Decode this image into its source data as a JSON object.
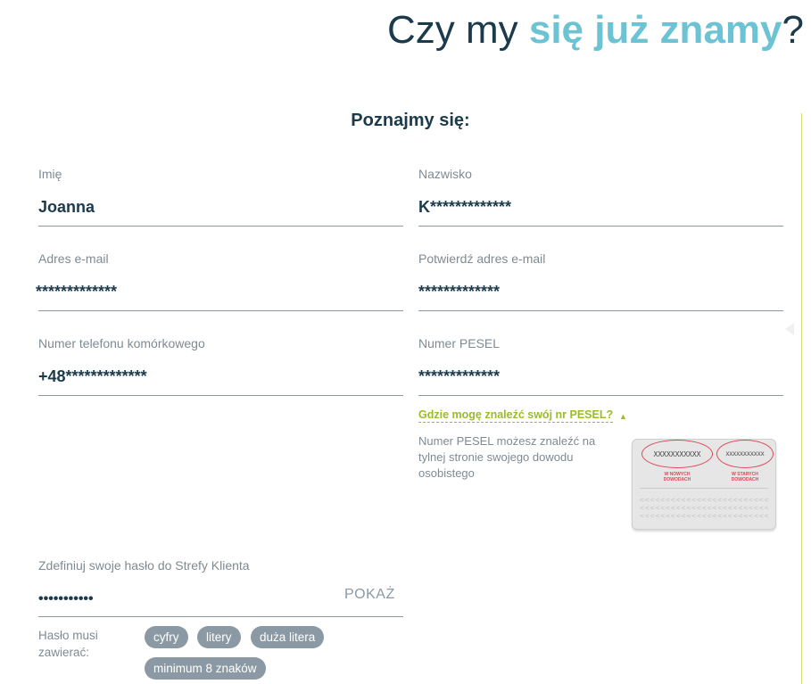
{
  "header": {
    "title_prefix": "Czy my ",
    "title_accent": "się już znamy",
    "title_suffix": "?"
  },
  "form": {
    "section_title": "Poznajmy się:",
    "first_name": {
      "label": "Imię",
      "value": "Joanna"
    },
    "last_name": {
      "label": "Nazwisko",
      "value": "K*************"
    },
    "email": {
      "label": "Adres e-mail",
      "value": "*************"
    },
    "email_confirm": {
      "label": "Potwierdź adres e-mail",
      "value": "*************"
    },
    "phone": {
      "label": "Numer telefonu komórkowego",
      "prefix": "+48",
      "value": "*************"
    },
    "pesel": {
      "label": "Numer PESEL",
      "value": "*************"
    },
    "pesel_help": {
      "link": "Gdzie mogę znaleźć swój nr PESEL?",
      "text": "Numer PESEL możesz znaleźć na tylnej stronie swojego dowodu osobistego",
      "card": {
        "number_left": "XXXXXXXXXXX",
        "number_right": "XXXXXXXXXXX",
        "caption_left": "W NOWYCH DOWODACH",
        "caption_right": "W STARYCH DOWODACH",
        "mrz_line": "<<<<<<<<<<<<<<<<<<<<<<<<<<<<<<<<<<<<"
      }
    },
    "password": {
      "label": "Zdefiniuj swoje hasło do Strefy Klienta",
      "value": "•••••••••••",
      "show_label": "POKAŻ",
      "requirements_label": "Hasło musi zawierać:",
      "requirements": [
        "cyfry",
        "litery",
        "duża litera",
        "minimum 8 znaków"
      ]
    }
  },
  "colors": {
    "primary_text": "#1b3a4b",
    "accent": "#6cc3d3",
    "link": "#9bbb2a",
    "chip_bg": "#8a99a3",
    "label": "#7f8a92"
  }
}
